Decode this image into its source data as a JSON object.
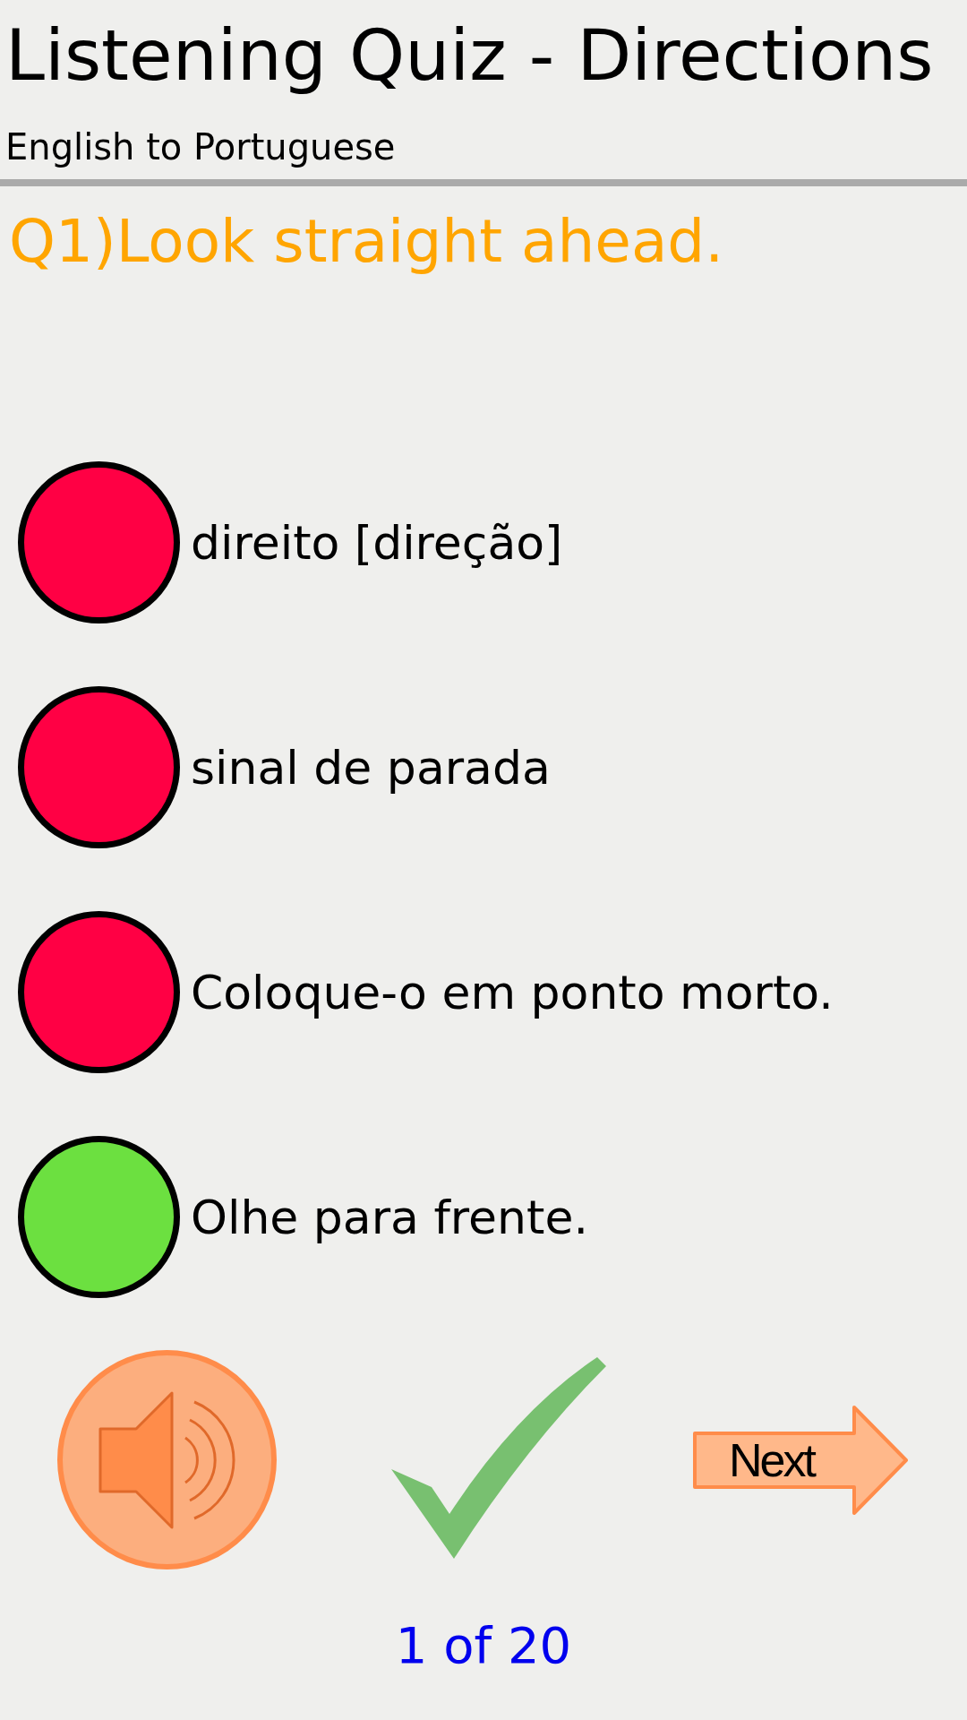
{
  "header": {
    "title": "Listening Quiz - Directions",
    "subtitle": "English to Portuguese"
  },
  "question": "Q1)Look straight ahead.",
  "options": [
    {
      "text": "direito [direção]",
      "color": "#ff0044"
    },
    {
      "text": "sinal de parada",
      "color": "#ff0044"
    },
    {
      "text": "Coloque-o em ponto morto.",
      "color": "#ff0044"
    },
    {
      "text": "Olhe para frente.",
      "color": "#6ce040"
    }
  ],
  "next_button": "Next",
  "progress": "1 of 20"
}
